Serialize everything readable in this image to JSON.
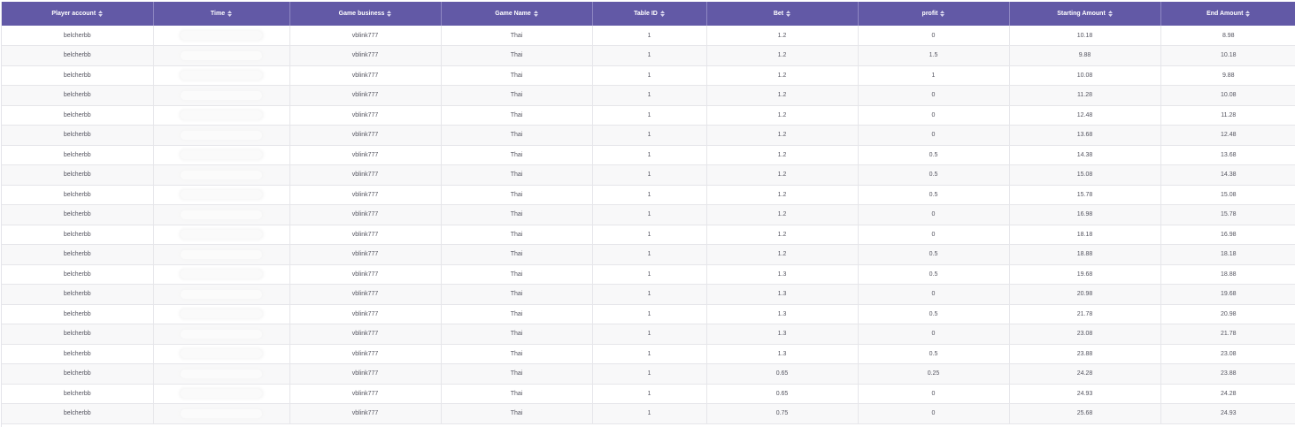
{
  "table": {
    "columns": [
      {
        "label": "Player account",
        "key": "player_account"
      },
      {
        "label": "Time",
        "key": "time"
      },
      {
        "label": "Game business",
        "key": "game_business"
      },
      {
        "label": "Game Name",
        "key": "game_name"
      },
      {
        "label": "Table ID",
        "key": "table_id"
      },
      {
        "label": "Bet",
        "key": "bet"
      },
      {
        "label": "profit",
        "key": "profit"
      },
      {
        "label": "Starting Amount",
        "key": "starting_amount"
      },
      {
        "label": "End Amount",
        "key": "end_amount"
      }
    ],
    "rows": [
      {
        "player_account": "belcherbb",
        "time": "",
        "game_business": "vblink777",
        "game_name": "Thai",
        "table_id": "1",
        "bet": "1.2",
        "profit": "0",
        "starting_amount": "10.18",
        "end_amount": "8.98"
      },
      {
        "player_account": "belcherbb",
        "time": "",
        "game_business": "vblink777",
        "game_name": "Thai",
        "table_id": "1",
        "bet": "1.2",
        "profit": "1.5",
        "starting_amount": "9.88",
        "end_amount": "10.18"
      },
      {
        "player_account": "belcherbb",
        "time": "",
        "game_business": "vblink777",
        "game_name": "Thai",
        "table_id": "1",
        "bet": "1.2",
        "profit": "1",
        "starting_amount": "10.08",
        "end_amount": "9.88"
      },
      {
        "player_account": "belcherbb",
        "time": "",
        "game_business": "vblink777",
        "game_name": "Thai",
        "table_id": "1",
        "bet": "1.2",
        "profit": "0",
        "starting_amount": "11.28",
        "end_amount": "10.08"
      },
      {
        "player_account": "belcherbb",
        "time": "",
        "game_business": "vblink777",
        "game_name": "Thai",
        "table_id": "1",
        "bet": "1.2",
        "profit": "0",
        "starting_amount": "12.48",
        "end_amount": "11.28"
      },
      {
        "player_account": "belcherbb",
        "time": "",
        "game_business": "vblink777",
        "game_name": "Thai",
        "table_id": "1",
        "bet": "1.2",
        "profit": "0",
        "starting_amount": "13.68",
        "end_amount": "12.48"
      },
      {
        "player_account": "belcherbb",
        "time": "",
        "game_business": "vblink777",
        "game_name": "Thai",
        "table_id": "1",
        "bet": "1.2",
        "profit": "0.5",
        "starting_amount": "14.38",
        "end_amount": "13.68"
      },
      {
        "player_account": "belcherbb",
        "time": "",
        "game_business": "vblink777",
        "game_name": "Thai",
        "table_id": "1",
        "bet": "1.2",
        "profit": "0.5",
        "starting_amount": "15.08",
        "end_amount": "14.38"
      },
      {
        "player_account": "belcherbb",
        "time": "",
        "game_business": "vblink777",
        "game_name": "Thai",
        "table_id": "1",
        "bet": "1.2",
        "profit": "0.5",
        "starting_amount": "15.78",
        "end_amount": "15.08"
      },
      {
        "player_account": "belcherbb",
        "time": "",
        "game_business": "vblink777",
        "game_name": "Thai",
        "table_id": "1",
        "bet": "1.2",
        "profit": "0",
        "starting_amount": "16.98",
        "end_amount": "15.78"
      },
      {
        "player_account": "belcherbb",
        "time": "",
        "game_business": "vblink777",
        "game_name": "Thai",
        "table_id": "1",
        "bet": "1.2",
        "profit": "0",
        "starting_amount": "18.18",
        "end_amount": "16.98"
      },
      {
        "player_account": "belcherbb",
        "time": "",
        "game_business": "vblink777",
        "game_name": "Thai",
        "table_id": "1",
        "bet": "1.2",
        "profit": "0.5",
        "starting_amount": "18.88",
        "end_amount": "18.18"
      },
      {
        "player_account": "belcherbb",
        "time": "",
        "game_business": "vblink777",
        "game_name": "Thai",
        "table_id": "1",
        "bet": "1.3",
        "profit": "0.5",
        "starting_amount": "19.68",
        "end_amount": "18.88"
      },
      {
        "player_account": "belcherbb",
        "time": "",
        "game_business": "vblink777",
        "game_name": "Thai",
        "table_id": "1",
        "bet": "1.3",
        "profit": "0",
        "starting_amount": "20.98",
        "end_amount": "19.68"
      },
      {
        "player_account": "belcherbb",
        "time": "",
        "game_business": "vblink777",
        "game_name": "Thai",
        "table_id": "1",
        "bet": "1.3",
        "profit": "0.5",
        "starting_amount": "21.78",
        "end_amount": "20.98"
      },
      {
        "player_account": "belcherbb",
        "time": "",
        "game_business": "vblink777",
        "game_name": "Thai",
        "table_id": "1",
        "bet": "1.3",
        "profit": "0",
        "starting_amount": "23.08",
        "end_amount": "21.78"
      },
      {
        "player_account": "belcherbb",
        "time": "",
        "game_business": "vblink777",
        "game_name": "Thai",
        "table_id": "1",
        "bet": "1.3",
        "profit": "0.5",
        "starting_amount": "23.88",
        "end_amount": "23.08"
      },
      {
        "player_account": "belcherbb",
        "time": "",
        "game_business": "vblink777",
        "game_name": "Thai",
        "table_id": "1",
        "bet": "0.65",
        "profit": "0.25",
        "starting_amount": "24.28",
        "end_amount": "23.88"
      },
      {
        "player_account": "belcherbb",
        "time": "",
        "game_business": "vblink777",
        "game_name": "Thai",
        "table_id": "1",
        "bet": "0.65",
        "profit": "0",
        "starting_amount": "24.93",
        "end_amount": "24.28"
      },
      {
        "player_account": "belcherbb",
        "time": "",
        "game_business": "vblink777",
        "game_name": "Thai",
        "table_id": "1",
        "bet": "0.75",
        "profit": "0",
        "starting_amount": "25.68",
        "end_amount": "24.93"
      }
    ]
  },
  "theme": {
    "header_bg": "#6259a6",
    "header_text": "#ffffff",
    "row_alt_bg": "#f8f8f9",
    "cell_text": "#555560"
  },
  "icons": {
    "sort": "sort-icon"
  }
}
